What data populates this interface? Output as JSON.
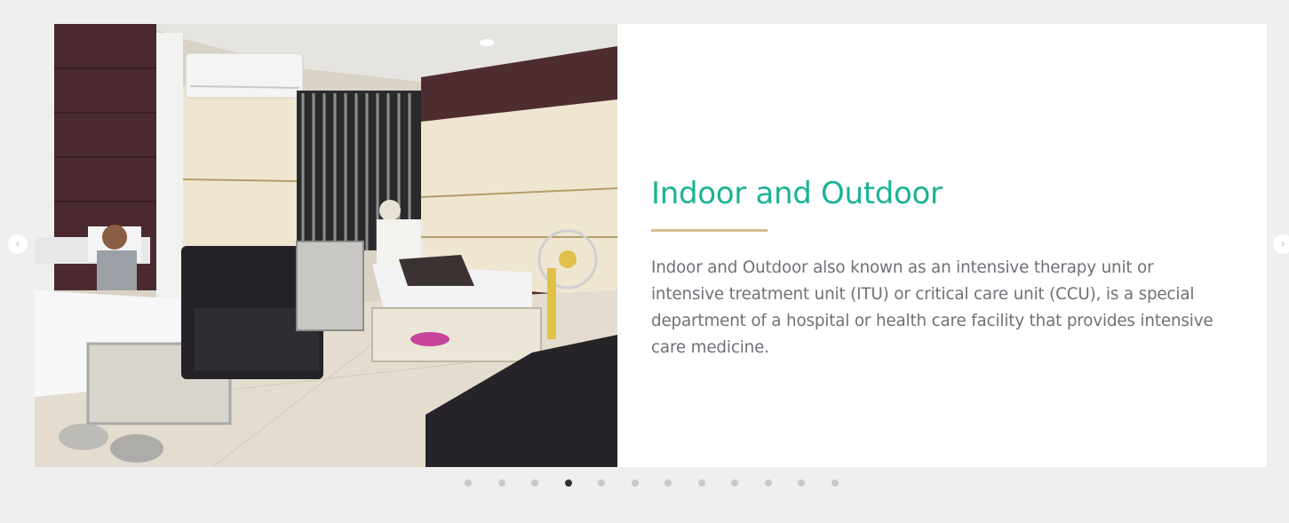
{
  "slide": {
    "image_alt": "Hospital ward with patients resting on beds",
    "title": "Indoor and Outdoor",
    "description": "Indoor and Outdoor also known as an intensive therapy unit or intensive treatment unit (ITU) or critical care unit (CCU), is a special department of a hospital or health care facility that provides intensive care medicine."
  },
  "navigation": {
    "prev_icon": "chevron-left-icon",
    "next_icon": "chevron-right-icon",
    "prev_glyph": "‹",
    "next_glyph": "›"
  },
  "pagination": {
    "total": 12,
    "active_index": 3
  },
  "colors": {
    "title": "#1ab394",
    "divider": "#d4bd8e",
    "text": "#6e7177",
    "background": "#efefef"
  }
}
